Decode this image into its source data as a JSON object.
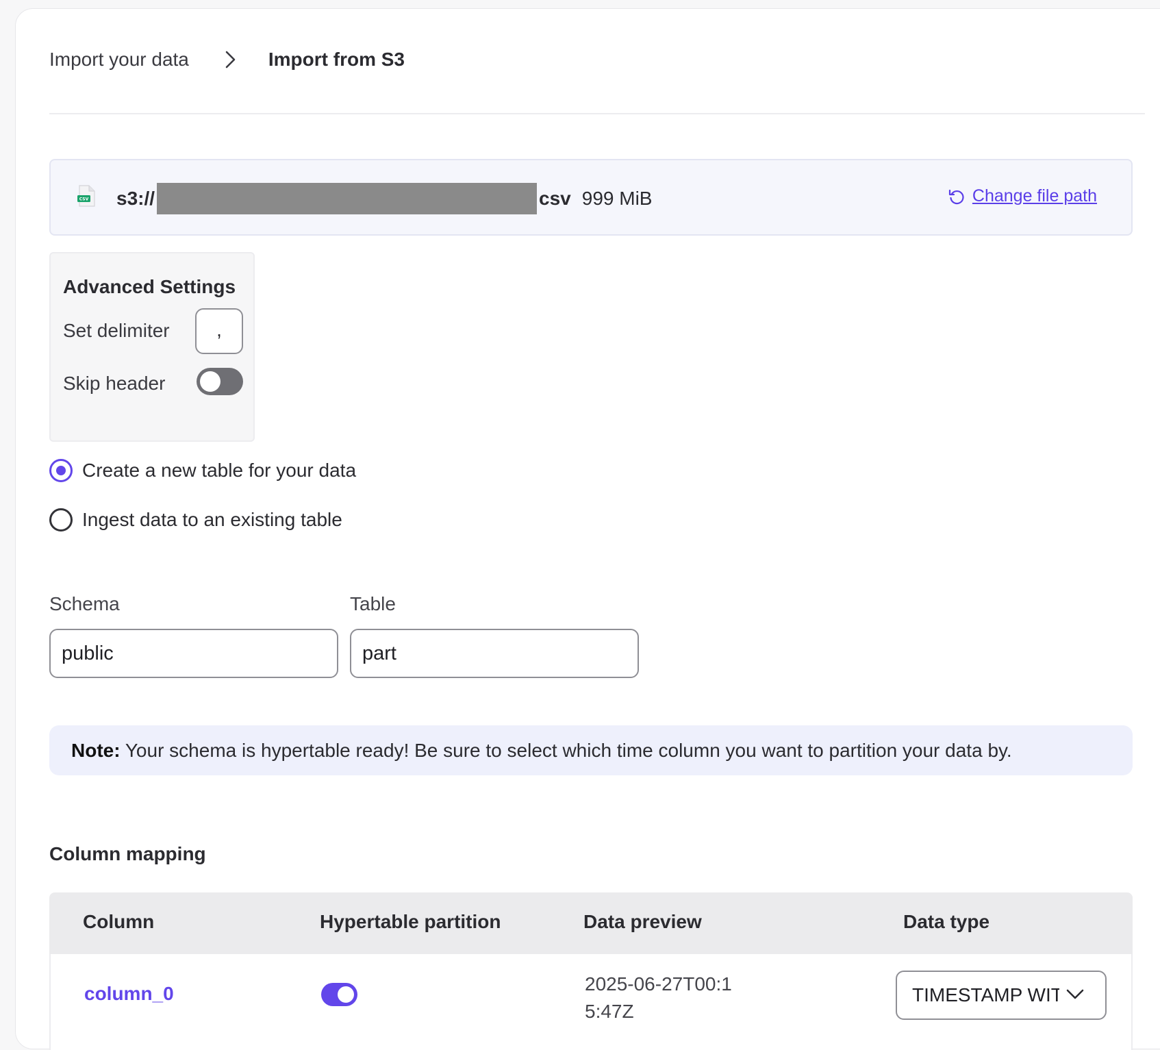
{
  "breadcrumb": {
    "parent": "Import your data",
    "current": "Import from S3"
  },
  "file": {
    "icon": "csv-file-icon",
    "path_prefix": "s3://",
    "path_suffix": "csv",
    "size": "999 MiB",
    "change_link": "Change file path"
  },
  "advanced": {
    "title": "Advanced Settings",
    "delimiter_label": "Set delimiter",
    "delimiter_value": ",",
    "skip_header_label": "Skip header",
    "skip_header_on": false
  },
  "mode": {
    "options": [
      {
        "label": "Create a new table for your data",
        "selected": true
      },
      {
        "label": "Ingest data to an existing table",
        "selected": false
      }
    ]
  },
  "target": {
    "schema_label": "Schema",
    "schema_value": "public",
    "table_label": "Table",
    "table_value": "part"
  },
  "note": {
    "prefix": "Note:",
    "text": " Your schema is hypertable ready! Be sure to select which time column you want to partition your data by."
  },
  "mapping": {
    "title": "Column mapping",
    "headers": [
      "Column",
      "Hypertable partition",
      "Data preview",
      "Data type"
    ],
    "rows": [
      {
        "column": "column_0",
        "partition_on": true,
        "preview": "2025-06-27T00:15:47Z",
        "type": "TIMESTAMP WITH TIME ZONE"
      }
    ]
  },
  "colors": {
    "accent": "#6246ea",
    "toggle_off": "#6f6f74",
    "note_bg": "#eef0fc",
    "file_bar_bg": "#f5f6fc"
  }
}
